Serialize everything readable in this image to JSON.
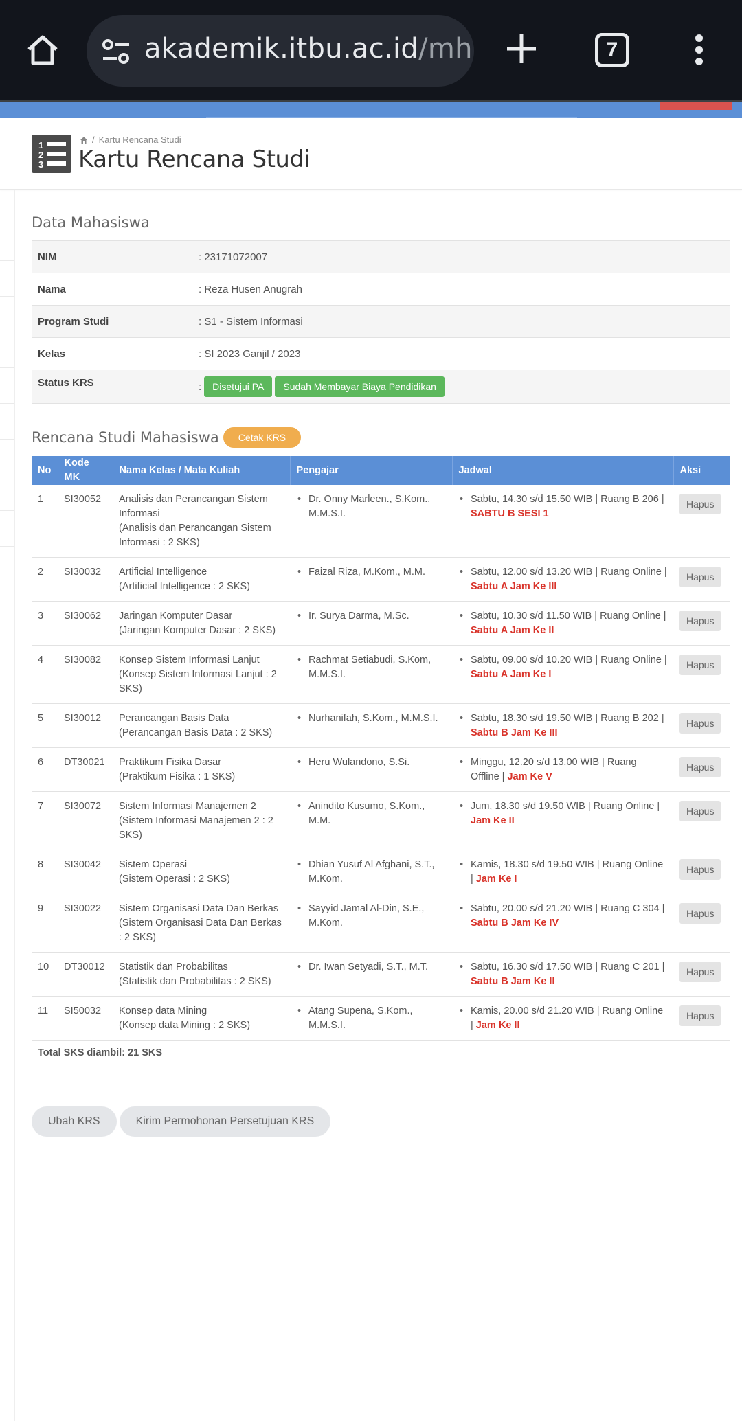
{
  "browser": {
    "url_domain": "akademik.itbu.ac.id",
    "url_rest": "/mhs-ke",
    "tab_count": "7"
  },
  "breadcrumb": {
    "current": "Kartu Rencana Studi"
  },
  "page": {
    "title": "Kartu Rencana Studi"
  },
  "mahasiswa": {
    "title": "Data Mahasiswa",
    "rows": [
      {
        "label": "NIM",
        "value": ": 23171072007"
      },
      {
        "label": "Nama",
        "value": ": Reza Husen Anugrah"
      },
      {
        "label": "Program Studi",
        "value": ": S1 - Sistem Informasi"
      },
      {
        "label": "Kelas",
        "value": ": SI 2023 Ganjil / 2023"
      }
    ],
    "status": {
      "label": "Status KRS",
      "prefix": ":",
      "badges": [
        "Disetujui PA",
        "Sudah Membayar Biaya Pendidikan"
      ]
    }
  },
  "rencana": {
    "title": "Rencana Studi Mahasiswa",
    "cetak_label": "Cetak KRS",
    "headers": [
      "No",
      "Kode MK",
      "Nama Kelas / Mata Kuliah",
      "Pengajar",
      "Jadwal",
      "Aksi"
    ],
    "hapus_label": "Hapus",
    "rows": [
      {
        "no": "1",
        "kode": "SI30052",
        "nama": "Analisis dan Perancangan Sistem Informasi",
        "detail": "(Analisis dan Perancangan Sistem Informasi : 2 SKS)",
        "pengajar": "Dr. Onny Marleen., S.Kom., M.M.S.I.",
        "jadwal": "Sabtu, 14.30 s/d 15.50 WIB | Ruang B 206 | ",
        "sesi": "SABTU B SESI 1"
      },
      {
        "no": "2",
        "kode": "SI30032",
        "nama": "Artificial Intelligence",
        "detail": "(Artificial Intelligence : 2 SKS)",
        "pengajar": "Faizal Riza, M.Kom., M.M.",
        "jadwal": "Sabtu, 12.00 s/d 13.20 WIB | Ruang Online | ",
        "sesi": "Sabtu A Jam Ke III"
      },
      {
        "no": "3",
        "kode": "SI30062",
        "nama": "Jaringan Komputer Dasar",
        "detail": "(Jaringan Komputer Dasar : 2 SKS)",
        "pengajar": "Ir. Surya Darma, M.Sc.",
        "jadwal": "Sabtu, 10.30 s/d 11.50 WIB | Ruang Online | ",
        "sesi": "Sabtu A Jam Ke II"
      },
      {
        "no": "4",
        "kode": "SI30082",
        "nama": "Konsep Sistem Informasi Lanjut",
        "detail": "(Konsep Sistem Informasi Lanjut : 2 SKS)",
        "pengajar": "Rachmat Setiabudi, S.Kom, M.M.S.I.",
        "jadwal": "Sabtu, 09.00 s/d 10.20 WIB | Ruang Online | ",
        "sesi": "Sabtu A Jam Ke I"
      },
      {
        "no": "5",
        "kode": "SI30012",
        "nama": "Perancangan Basis Data",
        "detail": "(Perancangan Basis Data : 2 SKS)",
        "pengajar": "Nurhanifah, S.Kom., M.M.S.I.",
        "jadwal": "Sabtu, 18.30 s/d 19.50 WIB | Ruang B 202 | ",
        "sesi": "Sabtu B Jam Ke III"
      },
      {
        "no": "6",
        "kode": "DT30021",
        "nama": "Praktikum Fisika Dasar",
        "detail": "(Praktikum Fisika : 1 SKS)",
        "pengajar": "Heru Wulandono, S.Si.",
        "jadwal": "Minggu, 12.20 s/d 13.00 WIB | Ruang Offline | ",
        "sesi": "Jam Ke V"
      },
      {
        "no": "7",
        "kode": "SI30072",
        "nama": "Sistem Informasi Manajemen 2",
        "detail": "(Sistem Informasi Manajemen 2 : 2 SKS)",
        "pengajar": "Anindito Kusumo, S.Kom., M.M.",
        "jadwal": "Jum, 18.30 s/d 19.50 WIB | Ruang Online | ",
        "sesi": "Jam Ke II"
      },
      {
        "no": "8",
        "kode": "SI30042",
        "nama": "Sistem Operasi",
        "detail": "(Sistem Operasi : 2 SKS)",
        "pengajar": "Dhian Yusuf Al Afghani, S.T., M.Kom.",
        "jadwal": "Kamis, 18.30 s/d 19.50 WIB | Ruang Online | ",
        "sesi": "Jam Ke I"
      },
      {
        "no": "9",
        "kode": "SI30022",
        "nama": "Sistem Organisasi Data Dan Berkas",
        "detail": "(Sistem Organisasi Data Dan Berkas : 2 SKS)",
        "pengajar": "Sayyid Jamal Al-Din, S.E., M.Kom.",
        "jadwal": "Sabtu, 20.00 s/d 21.20 WIB | Ruang C 304 | ",
        "sesi": "Sabtu B Jam Ke IV"
      },
      {
        "no": "10",
        "kode": "DT30012",
        "nama": "Statistik dan Probabilitas",
        "detail": "(Statistik dan Probabilitas : 2 SKS)",
        "pengajar": "Dr. Iwan Setyadi, S.T., M.T.",
        "jadwal": "Sabtu, 16.30 s/d 17.50 WIB | Ruang C 201 | ",
        "sesi": "Sabtu B Jam Ke II"
      },
      {
        "no": "11",
        "kode": "SI50032",
        "nama": "Konsep data Mining",
        "detail": "(Konsep data Mining : 2 SKS)",
        "pengajar": "Atang Supena, S.Kom., M.M.S.I.",
        "jadwal": "Kamis, 20.00 s/d 21.20 WIB | Ruang Online | ",
        "sesi": "Jam Ke II"
      }
    ],
    "total": "Total SKS diambil: 21 SKS"
  },
  "actions": {
    "ubah": "Ubah KRS",
    "kirim": "Kirim Permohonan Persetujuan KRS"
  },
  "colors": {
    "header_blue": "#5b8fd6",
    "badge_green": "#5cb85c",
    "cetak_orange": "#f0ad4e",
    "sesi_red": "#d9342b"
  }
}
